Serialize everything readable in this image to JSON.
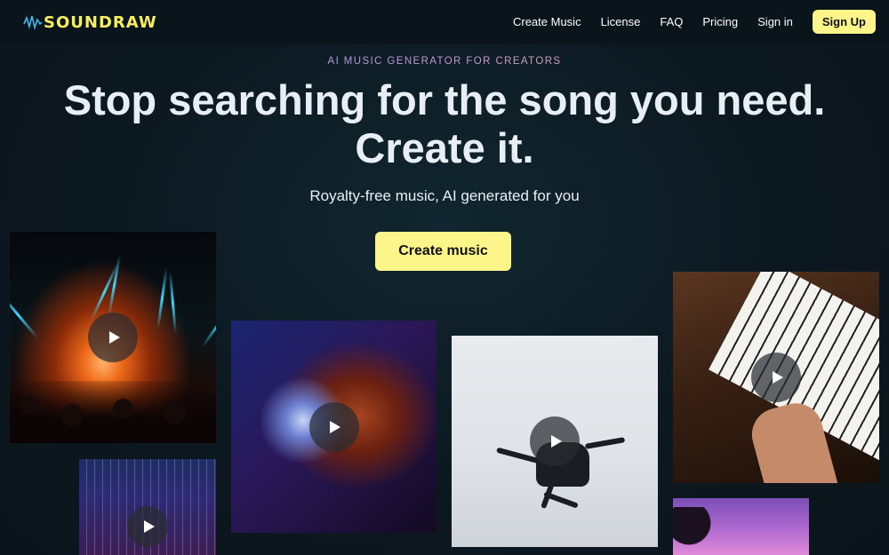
{
  "nav": {
    "logo_text": "SOUNDRAW",
    "links": [
      "Create Music",
      "License",
      "FAQ",
      "Pricing",
      "Sign in"
    ],
    "signup_label": "Sign Up"
  },
  "hero": {
    "eyebrow": "AI MUSIC GENERATOR FOR CREATORS",
    "headline_line1": "Stop searching for the song you need.",
    "headline_line2": "Create it.",
    "subtitle": "Royalty-free music, AI generated for you",
    "cta_label": "Create music"
  },
  "colors": {
    "accent": "#fbf58a",
    "logo": "#f6ee5e",
    "background": "#0d1a22"
  },
  "cards": [
    {
      "subject": "concert",
      "icon": "play-icon"
    },
    {
      "subject": "disco-ball",
      "icon": "play-icon"
    },
    {
      "subject": "dancer",
      "icon": "play-icon"
    },
    {
      "subject": "piano",
      "icon": "play-icon"
    },
    {
      "subject": "city-night",
      "icon": "play-icon"
    },
    {
      "subject": "palm-sunset",
      "icon": "none"
    }
  ]
}
